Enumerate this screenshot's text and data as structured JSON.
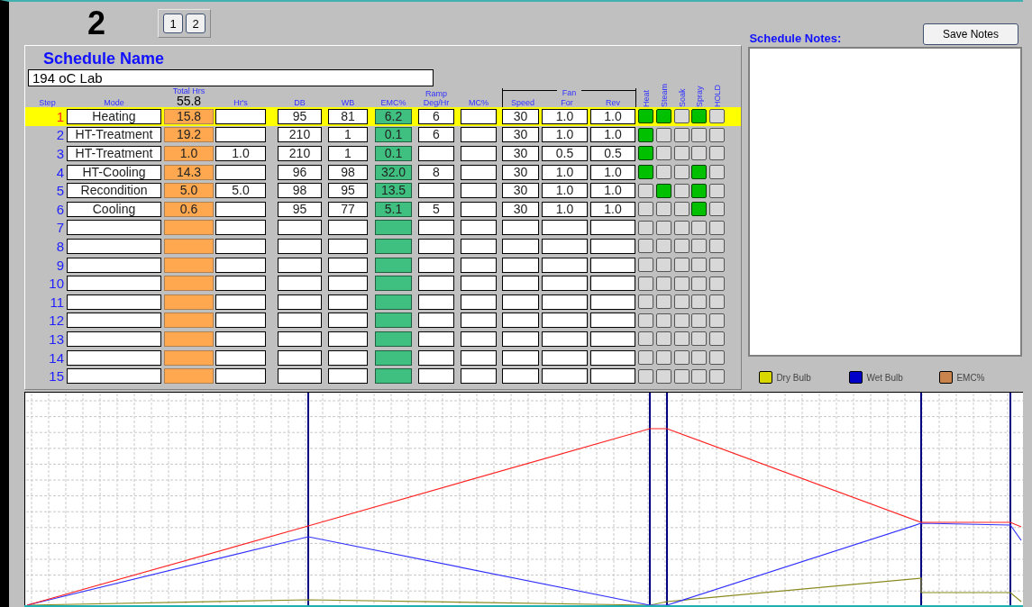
{
  "schedule_number": "2",
  "pages": [
    "1",
    "2"
  ],
  "schedule_name": {
    "label": "Schedule Name",
    "value": "194 oC Lab"
  },
  "headers": {
    "step": "Step",
    "mode": "Mode",
    "total_label": "Total Hrs",
    "total_value": "55.8",
    "hrs": "Hr's",
    "db": "DB",
    "wb": "WB",
    "emc": "EMC%",
    "ramp": "Ramp Deg/Hr",
    "mc": "MC%",
    "fan": "Fan",
    "speed": "Speed",
    "for": "For",
    "rev": "Rev",
    "flags": [
      "Heat",
      "Steam",
      "Soak",
      "Spray",
      "HOLD"
    ]
  },
  "rows": [
    {
      "step": "1",
      "selected": true,
      "mode": "Heating",
      "total": "15.8",
      "db": "95",
      "wb": "81",
      "emc": "6.2",
      "ramp": "6",
      "speed": "30",
      "for": "1.0",
      "rev": "1.0",
      "flags": [
        true,
        true,
        false,
        true,
        false
      ]
    },
    {
      "step": "2",
      "selected": false,
      "mode": "HT-Treatment",
      "total": "19.2",
      "db": "210",
      "wb": "1",
      "emc": "0.1",
      "ramp": "6",
      "speed": "30",
      "for": "1.0",
      "rev": "1.0",
      "flags": [
        true,
        false,
        false,
        false,
        false
      ]
    },
    {
      "step": "3",
      "selected": false,
      "mode": "HT-Treatment",
      "total": "1.0",
      "hrs": "1.0",
      "db": "210",
      "wb": "1",
      "emc": "0.1",
      "speed": "30",
      "for": "0.5",
      "rev": "0.5",
      "flags": [
        true,
        false,
        false,
        false,
        false
      ]
    },
    {
      "step": "4",
      "selected": false,
      "mode": "HT-Cooling",
      "total": "14.3",
      "db": "96",
      "wb": "98",
      "emc": "32.0",
      "ramp": "8",
      "speed": "30",
      "for": "1.0",
      "rev": "1.0",
      "flags": [
        true,
        false,
        false,
        true,
        false
      ]
    },
    {
      "step": "5",
      "selected": false,
      "mode": "Recondition",
      "total": "5.0",
      "hrs": "5.0",
      "db": "98",
      "wb": "95",
      "emc": "13.5",
      "speed": "30",
      "for": "1.0",
      "rev": "1.0",
      "flags": [
        false,
        true,
        false,
        true,
        false
      ]
    },
    {
      "step": "6",
      "selected": false,
      "mode": "Cooling",
      "total": "0.6",
      "db": "95",
      "wb": "77",
      "emc": "5.1",
      "ramp": "5",
      "speed": "30",
      "for": "1.0",
      "rev": "1.0",
      "flags": [
        false,
        false,
        false,
        true,
        false
      ]
    },
    {
      "step": "7",
      "selected": false,
      "flags": [
        false,
        false,
        false,
        false,
        false
      ]
    },
    {
      "step": "8",
      "selected": false,
      "flags": [
        false,
        false,
        false,
        false,
        false
      ]
    },
    {
      "step": "9",
      "selected": false,
      "flags": [
        false,
        false,
        false,
        false,
        false
      ]
    },
    {
      "step": "10",
      "selected": false,
      "flags": [
        false,
        false,
        false,
        false,
        false
      ]
    },
    {
      "step": "11",
      "selected": false,
      "flags": [
        false,
        false,
        false,
        false,
        false
      ]
    },
    {
      "step": "12",
      "selected": false,
      "flags": [
        false,
        false,
        false,
        false,
        false
      ]
    },
    {
      "step": "13",
      "selected": false,
      "flags": [
        false,
        false,
        false,
        false,
        false
      ]
    },
    {
      "step": "14",
      "selected": false,
      "flags": [
        false,
        false,
        false,
        false,
        false
      ]
    },
    {
      "step": "15",
      "selected": false,
      "flags": [
        false,
        false,
        false,
        false,
        false
      ]
    }
  ],
  "notes": {
    "label": "Schedule Notes:",
    "button": "Save Notes"
  },
  "legend": [
    {
      "label": "Dry Bulb",
      "color": "#d8d800"
    },
    {
      "label": "Wet Bulb",
      "color": "#0000c8"
    },
    {
      "label": "EMC%",
      "color": "#c8844c"
    }
  ]
}
